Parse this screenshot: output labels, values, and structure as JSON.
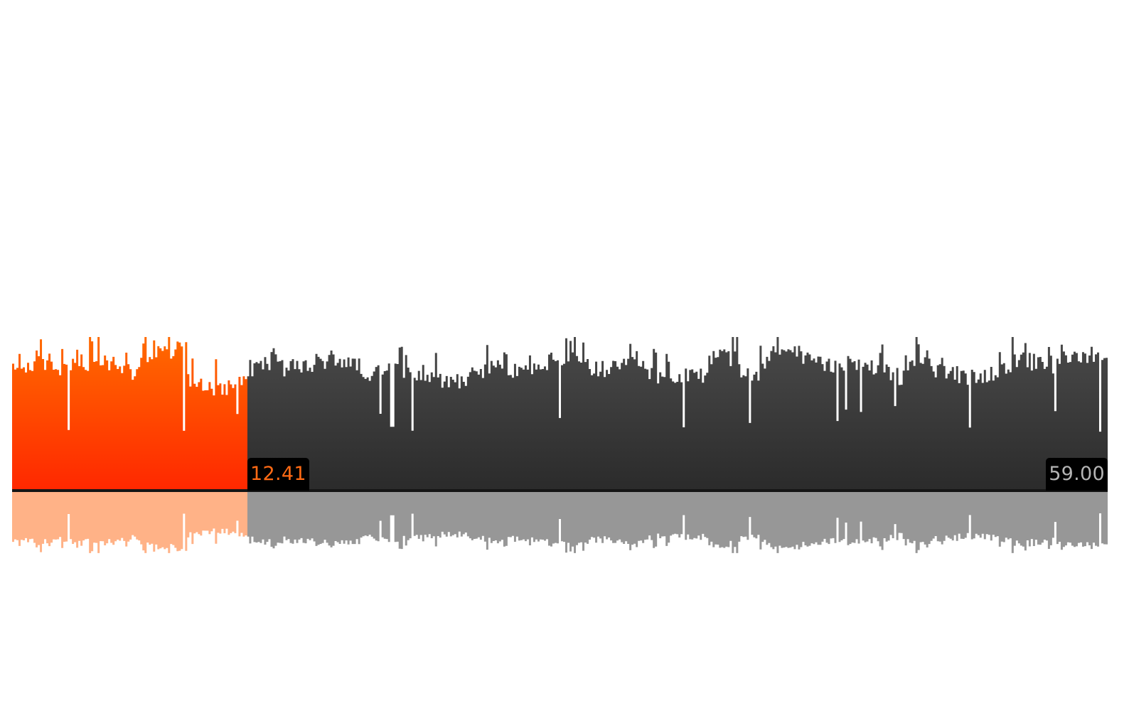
{
  "player": {
    "elapsed_label": "12.41",
    "total_label": "59.00",
    "progress_fraction": 0.215,
    "colors": {
      "played": "#ff5a00",
      "played_top": "#ff6a00",
      "played_bottom": "#ff2800",
      "unplayed_top": "#4a4a4a",
      "unplayed_bottom": "#2b2b2b",
      "played_reflection": "#ffb287",
      "unplayed_reflection": "#979797",
      "elapsed_text": "#ff6a14",
      "total_text": "#b4b4b4",
      "baseline": "#151515"
    }
  }
}
